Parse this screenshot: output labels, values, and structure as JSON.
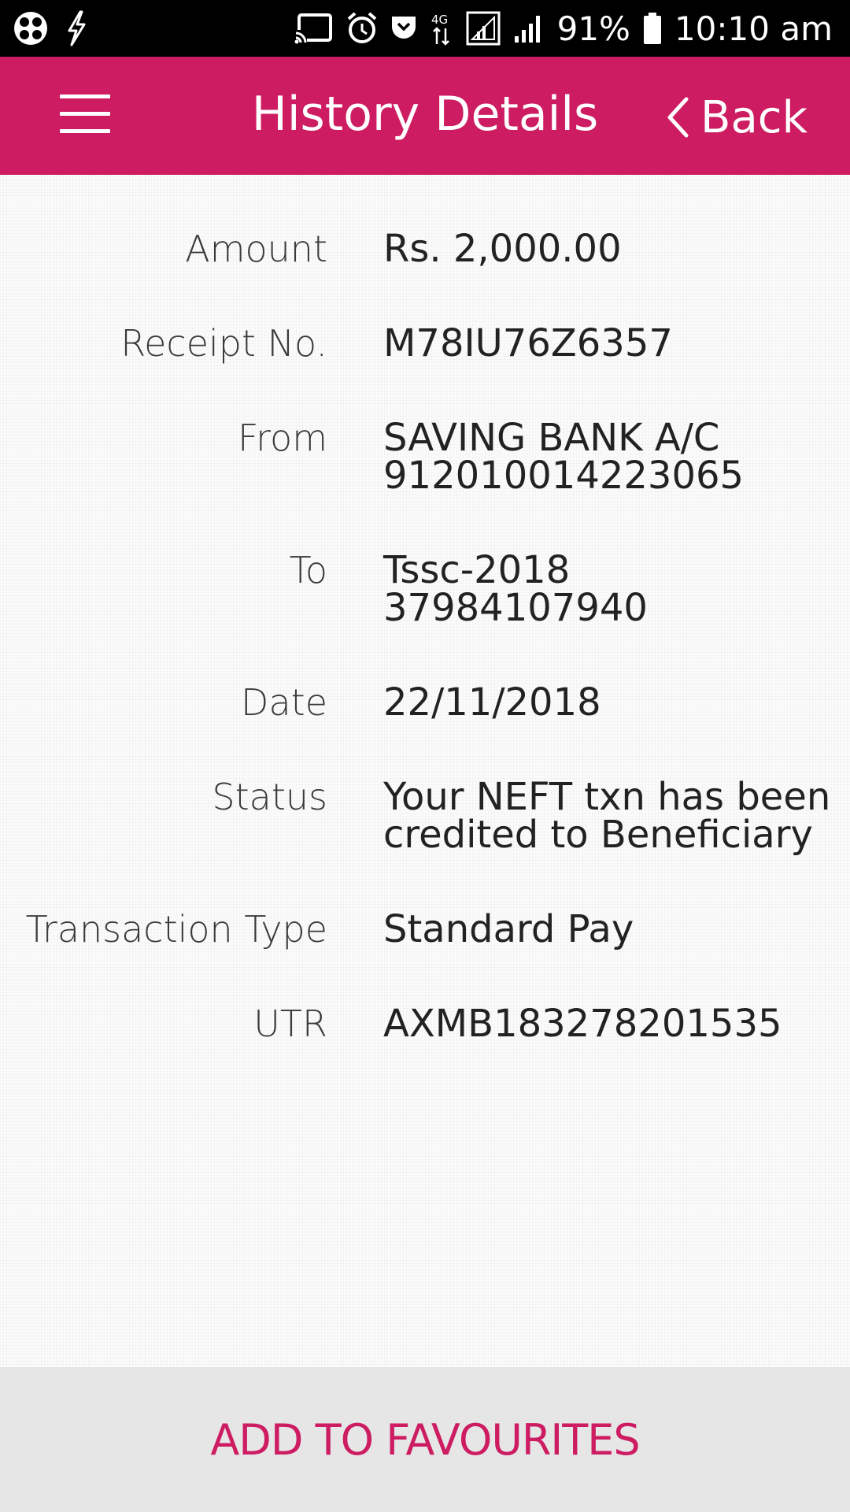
{
  "status_bar": {
    "battery_percent": "91%",
    "time": "10:10 am",
    "network": "4G",
    "icons": [
      "app-icon",
      "bolt-icon",
      "cast-icon",
      "alarm-icon",
      "pocket-icon",
      "data-arrows-icon",
      "signal-icon",
      "signal-icon",
      "battery-icon"
    ]
  },
  "app_bar": {
    "title": "History Details",
    "back_label": "Back",
    "menu_icon": "hamburger-menu-icon",
    "back_icon": "chevron-left-icon",
    "background_color": "#cd1c62"
  },
  "details": {
    "amount": {
      "label": "Amount",
      "value": "Rs. 2,000.00"
    },
    "receipt": {
      "label": "Receipt No.",
      "value": "M78IU76Z6357"
    },
    "from": {
      "label": "From",
      "line1": "SAVING BANK A/C",
      "line2": "912010014223065"
    },
    "to": {
      "label": "To",
      "line1": "Tssc-2018",
      "line2": "37984107940"
    },
    "date": {
      "label": "Date",
      "value": "22/11/2018"
    },
    "status": {
      "label": "Status",
      "line1": "Your NEFT txn has been",
      "line2": "credited to Beneficiary"
    },
    "txn_type": {
      "label": "Transaction Type",
      "value": "Standard Pay"
    },
    "utr": {
      "label": "UTR",
      "value": "AXMB183278201535"
    }
  },
  "footer": {
    "action_label": "ADD TO FAVOURITES",
    "accent_color": "#cd1c62"
  }
}
